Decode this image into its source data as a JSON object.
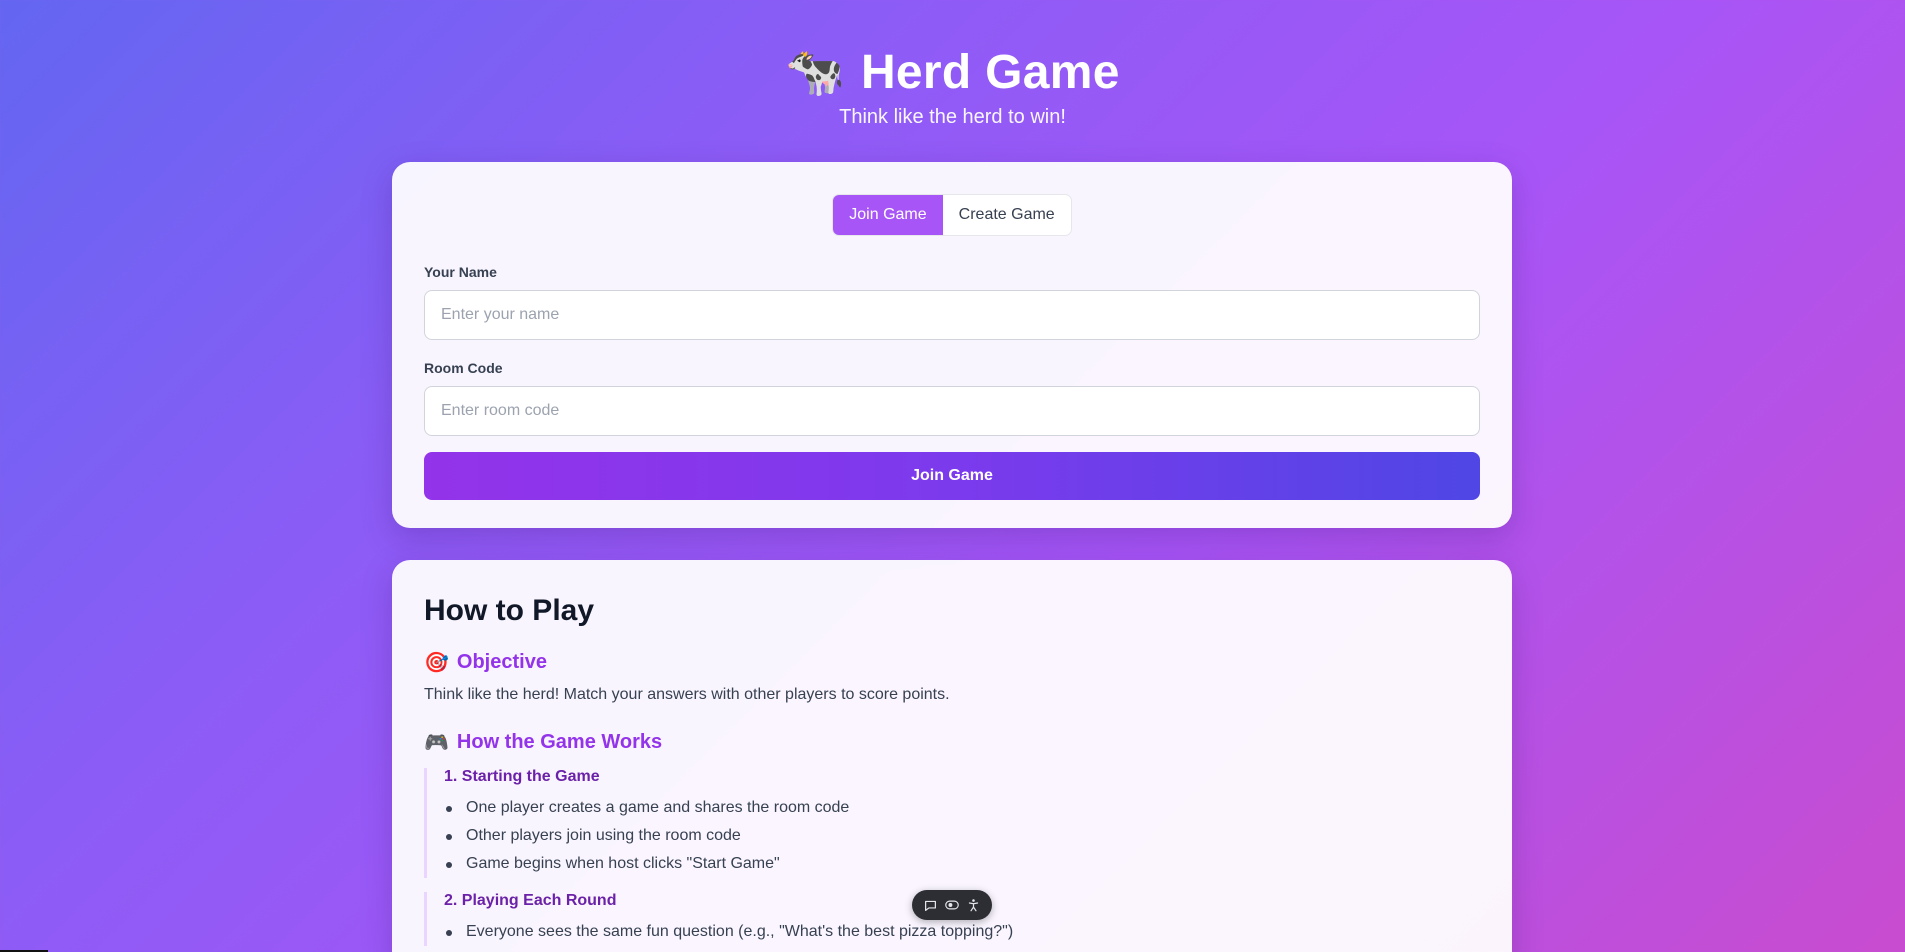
{
  "header": {
    "logo_icon": "cow-icon",
    "logo_glyph": "🐄",
    "title": "Herd Game",
    "subtitle": "Think like the herd to win!"
  },
  "join_card": {
    "tabs": [
      {
        "label": "Join Game",
        "active": true
      },
      {
        "label": "Create Game",
        "active": false
      }
    ],
    "name_field": {
      "label": "Your Name",
      "value": "",
      "placeholder": "Enter your name"
    },
    "room_field": {
      "label": "Room Code",
      "value": "",
      "placeholder": "Enter room code"
    },
    "submit_label": "Join Game"
  },
  "how_to_play": {
    "title": "How to Play",
    "objective": {
      "icon": "target-icon",
      "glyph": "🎯",
      "heading": "Objective",
      "text": "Think like the herd! Match your answers with other players to score points."
    },
    "game_works": {
      "icon": "gamepad-icon",
      "glyph": "🎮",
      "heading": "How the Game Works",
      "steps": [
        {
          "title": "1. Starting the Game",
          "items": [
            "One player creates a game and shares the room code",
            "Other players join using the room code",
            "Game begins when host clicks \"Start Game\""
          ]
        },
        {
          "title": "2. Playing Each Round",
          "items": [
            "Everyone sees the same fun question (e.g., \"What's the best pizza topping?\")"
          ]
        }
      ]
    }
  },
  "toolbar": {
    "icons": [
      "chat-icon",
      "toggle-icon",
      "accessibility-icon"
    ]
  },
  "colors": {
    "accent": "#a855f7",
    "heading_accent": "#9333ea",
    "step_title": "#6b21a8"
  }
}
